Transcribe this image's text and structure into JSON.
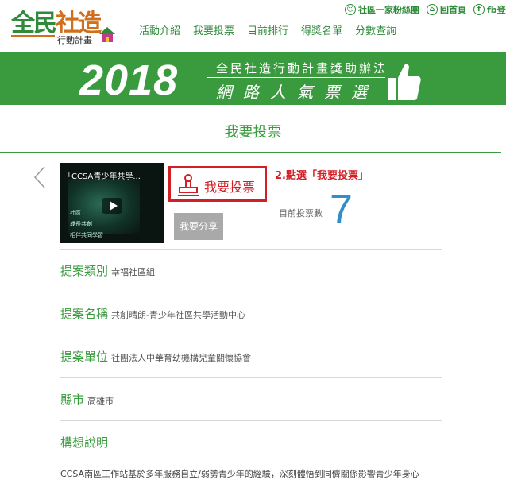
{
  "logo": {
    "line1a": "全民",
    "line1b": "社造",
    "sub": "行動計畫"
  },
  "nav": [
    "活動介紹",
    "我要投票",
    "目前排行",
    "得獎名單",
    "分數查詢"
  ],
  "toplinks": {
    "fans": "社區一家粉絲團",
    "home": "回首頁",
    "fb": "fb登入"
  },
  "banner": {
    "year": "2018",
    "line1": "全民社造行動計畫獎助辦法",
    "line2": "網路人氣票選"
  },
  "page_title": "我要投票",
  "video": {
    "title": "「CCSA青少年共學...",
    "captions": [
      "社區",
      "成長共創",
      "相伴共同學習"
    ]
  },
  "vote": {
    "button_label": "我要投票",
    "step_note": "2.點選「我要投票」"
  },
  "share_label": "我要分享",
  "count": {
    "label": "目前投票數",
    "value": "7"
  },
  "fields": [
    {
      "label": "提案類別",
      "value": "幸福社區組"
    },
    {
      "label": "提案名稱",
      "value": "共創晴朗-青少年社區共學活動中心"
    },
    {
      "label": "提案單位",
      "value": "社團法人中華育幼機構兒童關懷協會"
    },
    {
      "label": "縣市",
      "value": "高雄市"
    },
    {
      "label": "構想說明",
      "value": ""
    }
  ],
  "description": "CCSA南區工作站基於多年服務自立/弱勢青少年的經驗，深刻體悟到同儕關係影響青少年身心",
  "colors": {
    "brand_green": "#3a9b3e",
    "alert_red": "#d21e25",
    "count_blue": "#2f90c8"
  }
}
